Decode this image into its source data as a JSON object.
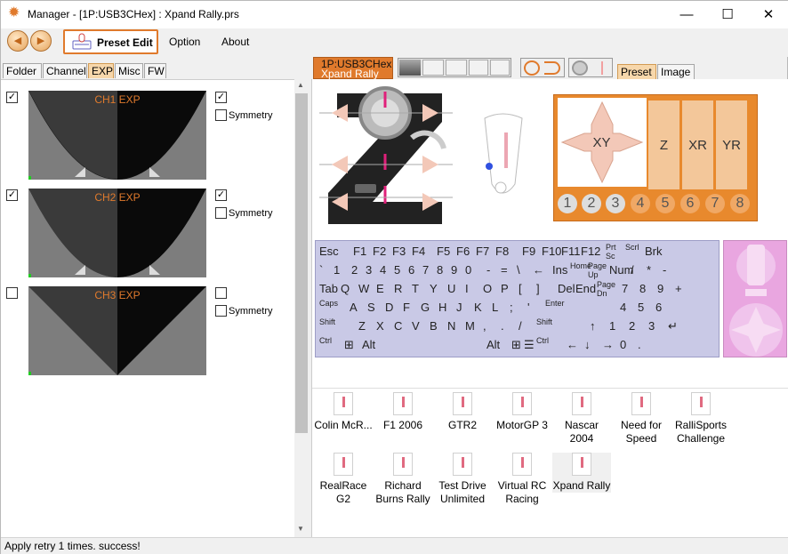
{
  "window": {
    "title": "Manager - [1P:USB3CHex] : Xpand Rally.prs",
    "minimize": "—",
    "maximize": "☐",
    "close": "✕"
  },
  "toolbar": {
    "back": "◀",
    "forward": "▶",
    "preset_edit": "Preset Edit",
    "menu": [
      "Option",
      "About"
    ]
  },
  "left_tabs": [
    "Folder",
    "Channel",
    "EXP",
    "Misc",
    "FW"
  ],
  "channels": [
    {
      "label": "CH1 EXP",
      "enabled": "✓",
      "linked": "✓",
      "symmetry": "Symmetry"
    },
    {
      "label": "CH2 EXP",
      "enabled": "✓",
      "linked": "✓",
      "symmetry": "Symmetry"
    },
    {
      "label": "CH3 EXP",
      "enabled": "",
      "linked": "",
      "symmetry": "Symmetry"
    }
  ],
  "device_tab": {
    "line1": "1P:USB3CHex",
    "line2": "Xpand Rally"
  },
  "right_tabs": [
    "Preset",
    "Image"
  ],
  "axes": [
    "XY",
    "Z",
    "XR",
    "YR"
  ],
  "buttons": [
    "1",
    "2",
    "3",
    "4",
    "5",
    "6",
    "7",
    "8"
  ],
  "keyboard": {
    "row1": [
      "Esc",
      "F1",
      "F2",
      "F3",
      "F4",
      "F5",
      "F6",
      "F7",
      "F8",
      "F9",
      "F10",
      "F11",
      "F12",
      "Prt Sc",
      "Scrl",
      "Brk"
    ],
    "row2": [
      "`",
      "1",
      "2",
      "3",
      "4",
      "5",
      "6",
      "7",
      "8",
      "9",
      "0",
      "-",
      "=",
      "\\",
      "←",
      "Ins",
      "Home",
      "Page Up",
      "Num",
      "/",
      "*",
      "-"
    ],
    "row3": [
      "Tab",
      "Q",
      "W",
      "E",
      "R",
      "T",
      "Y",
      "U",
      "I",
      "O",
      "P",
      "[",
      "]",
      "Del",
      "End",
      "Page Dn",
      "7",
      "8",
      "9",
      "+"
    ],
    "row4": [
      "Caps",
      "A",
      "S",
      "D",
      "F",
      "G",
      "H",
      "J",
      "K",
      "L",
      ";",
      "'",
      "Enter",
      "4",
      "5",
      "6"
    ],
    "row5": [
      "Shift",
      "Z",
      "X",
      "C",
      "V",
      "B",
      "N",
      "M",
      ",",
      ".",
      "/",
      "Shift",
      "↑",
      "1",
      "2",
      "3",
      "↵"
    ],
    "row6": [
      "Ctrl",
      "⊞",
      "Alt",
      "Alt",
      "⊞",
      "☰",
      "Ctrl",
      "←",
      "↓",
      "→",
      "0",
      "."
    ]
  },
  "games": [
    "Colin McR...",
    "F1 2006",
    "GTR2",
    "MotorGP 3",
    "Nascar 2004",
    "Need for Speed",
    "RalliSports Challenge",
    "RealRace G2",
    "Richard Burns  Rally",
    "Test Drive Unlimited",
    "Virtual RC Racing",
    "Xpand Rally"
  ],
  "status": "Apply retry  1 times. success!",
  "colors": {
    "accent": "#e07a2c",
    "tab_active": "#f7d7ab",
    "keyboard": "#c9c9e6",
    "pad": "#e9a6e0"
  }
}
